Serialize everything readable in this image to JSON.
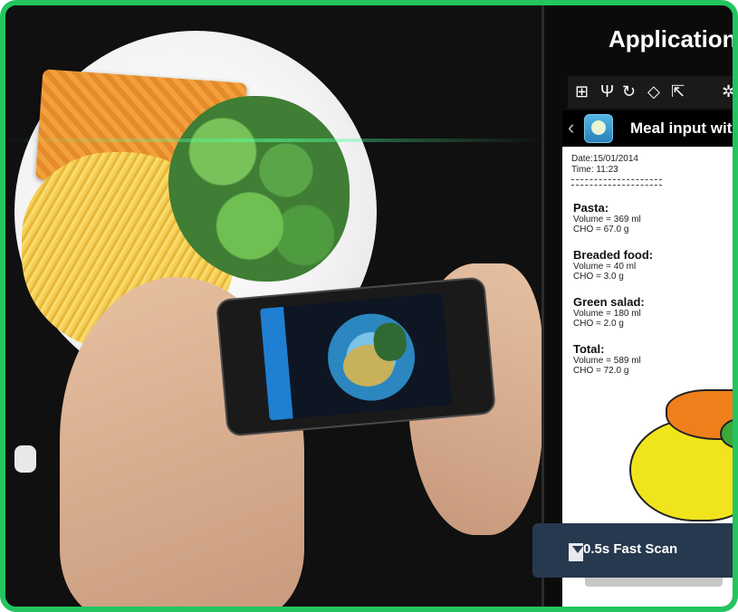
{
  "app": {
    "title": "Application",
    "header_title": "Meal input wit"
  },
  "report": {
    "date": "Date:15/01/2014",
    "time": "Time: 11:23",
    "items": [
      {
        "name": "Pasta:",
        "volume": "Volume = 369 ml",
        "cho": "CHO = 67.0 g"
      },
      {
        "name": "Breaded food:",
        "volume": "Volume = 40 ml",
        "cho": "CHO = 3.0 g"
      },
      {
        "name": "Green salad:",
        "volume": "Volume = 180 ml",
        "cho": "CHO = 2.0 g"
      },
      {
        "name": "Total:",
        "volume": "Volume = 589 ml",
        "cho": "CHO = 72.0 g"
      }
    ]
  },
  "banner": {
    "text": "0.5s Fast Scan"
  },
  "status_icons": [
    "plus-icon",
    "usb-icon",
    "sync-icon",
    "wifi-icon",
    "share-icon",
    "bluetooth-icon"
  ],
  "colors": {
    "frame": "#22c55e",
    "banner": "#27394f",
    "segment_orange": "#ef7f1a",
    "segment_yellow": "#f0e41d",
    "segment_green": "#3da83a"
  }
}
